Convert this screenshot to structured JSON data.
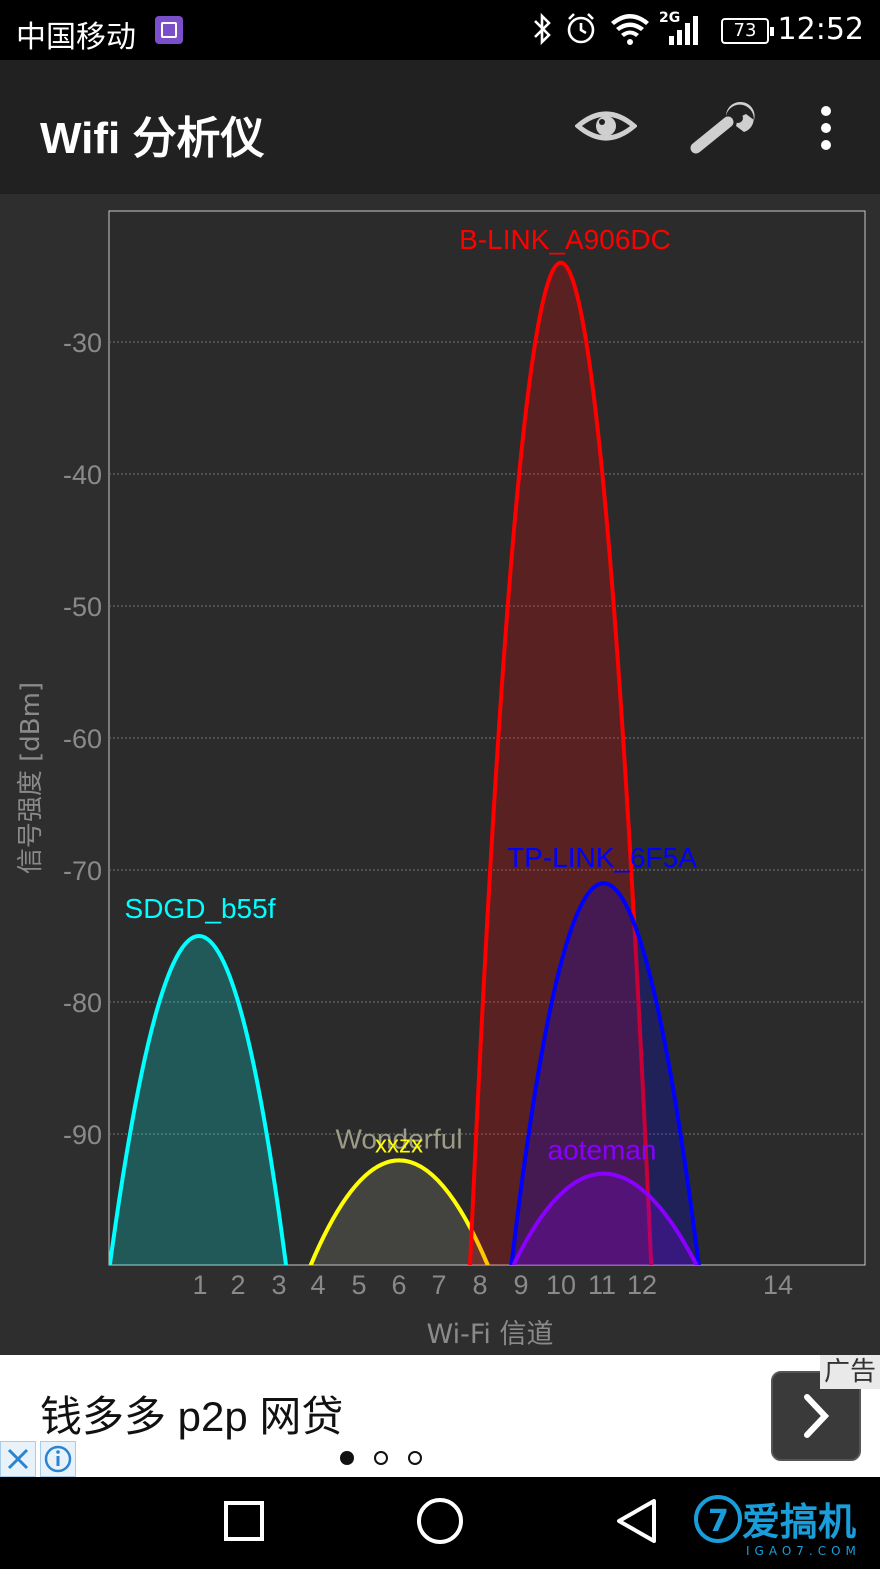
{
  "status_bar": {
    "carrier": "中国移动",
    "network": "2G",
    "battery": "73",
    "time": "12:52",
    "icons": [
      "gallery-icon",
      "bluetooth-icon",
      "alarm-icon",
      "wifi-icon",
      "signal-icon",
      "battery-icon"
    ]
  },
  "toolbar": {
    "title": "Wifi 分析仪",
    "actions": [
      "eye-icon",
      "wrench-icon",
      "more-vert-icon"
    ]
  },
  "chart_data": {
    "type": "area",
    "xlabel": "Wi-Fi 信道",
    "ylabel": "信号强度 [dBm]",
    "x_ticks": [
      "1",
      "2",
      "3",
      "4",
      "5",
      "6",
      "7",
      "8",
      "9",
      "10",
      "11",
      "12",
      "14"
    ],
    "y_ticks": [
      "-30",
      "-40",
      "-50",
      "-60",
      "-70",
      "-80",
      "-90"
    ],
    "ylim": [
      -100,
      -20
    ],
    "grid": "horizontal dotted",
    "series": [
      {
        "name": "SDGD_b55f",
        "channel": 1,
        "peak_dbm": -75,
        "start": -1.25,
        "end": 3.2,
        "color": "#00ffff"
      },
      {
        "name": "Wonderful",
        "channel": 6,
        "peak_dbm": -92,
        "start": 3.75,
        "end": 8.25,
        "color": "#9b9b88"
      },
      {
        "name": "xxzx",
        "channel": 6,
        "peak_dbm": -92,
        "start": 3.75,
        "end": 8.25,
        "color": "#ffff00"
      },
      {
        "name": "B-LINK_A906DC",
        "channel": 10,
        "peak_dbm": -24,
        "start": 7.75,
        "end": 12.25,
        "color": "#ff0000"
      },
      {
        "name": "TP-LINK_6F5A",
        "channel": 11,
        "peak_dbm": -71,
        "start": 8.75,
        "end": 13.2,
        "color": "#0000ff"
      },
      {
        "name": "aoteman",
        "channel": 11,
        "peak_dbm": -93,
        "start": 8.75,
        "end": 13.2,
        "color": "#8a00ff"
      }
    ]
  },
  "ad": {
    "text": "钱多多 p2p 网贷",
    "badge": "广告",
    "pager_pages": 3,
    "pager_active": 1
  },
  "nav_bar": [
    "recent-apps-icon",
    "home-icon",
    "back-icon"
  ],
  "watermark": {
    "text": "爱搞机",
    "sub": "IGAO7.COM"
  }
}
